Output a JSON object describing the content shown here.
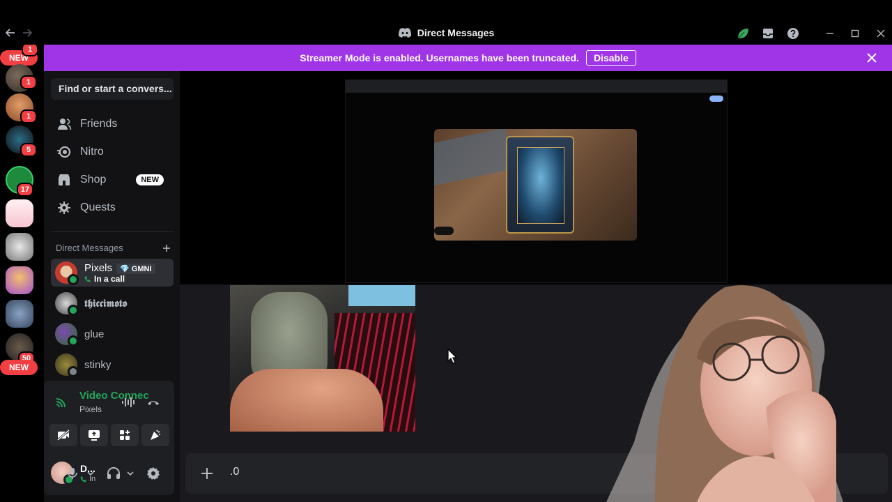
{
  "window": {
    "title": "Direct Messages",
    "controls": [
      "minimize",
      "maximize",
      "close"
    ],
    "icons": [
      "back-arrow-icon",
      "forward-arrow-icon",
      "leaf-icon",
      "inbox-icon",
      "help-icon"
    ]
  },
  "rail": {
    "guilds": [
      {
        "badge": "1"
      },
      {
        "badge": "1"
      },
      {
        "badge": "5"
      },
      {
        "badge": "17"
      },
      {
        "badge": ""
      },
      {
        "badge": ""
      },
      {
        "badge": ""
      },
      {
        "badge": ""
      },
      {
        "badge": "50"
      }
    ],
    "new_top": "NEW",
    "new_bottom": "NEW",
    "top_badge": "1"
  },
  "banner": {
    "message": "Streamer Mode is enabled. Usernames have been truncated.",
    "button": "Disable"
  },
  "sidebar": {
    "search_placeholder": "Find or start a convers...",
    "nav": [
      {
        "label": "Friends",
        "icon": "friends-icon"
      },
      {
        "label": "Nitro",
        "icon": "nitro-icon"
      },
      {
        "label": "Shop",
        "icon": "shop-icon",
        "badge": "NEW"
      },
      {
        "label": "Quests",
        "icon": "quests-icon"
      }
    ],
    "dm_header": "Direct Messages",
    "dms": [
      {
        "name": "Pixels",
        "tag": "GMNI",
        "sub": "In a call",
        "status_color": "#23a55a"
      },
      {
        "name": "𝖙𝖍𝖎𝖈𝖈𝖎𝖒𝖔𝖙𝖔",
        "status_color": "#23a55a"
      },
      {
        "name": "glue",
        "status_color": "#23a55a"
      },
      {
        "name": "stinky",
        "status_color": "#80848e"
      }
    ]
  },
  "voice": {
    "status": "Video Connected",
    "channel": "Pixels"
  },
  "user": {
    "name": "D...",
    "status": "In"
  },
  "composer": {
    "value": ".0"
  },
  "colors": {
    "banner": "#a035e8",
    "online": "#23a55a",
    "mention": "#f23f43"
  }
}
